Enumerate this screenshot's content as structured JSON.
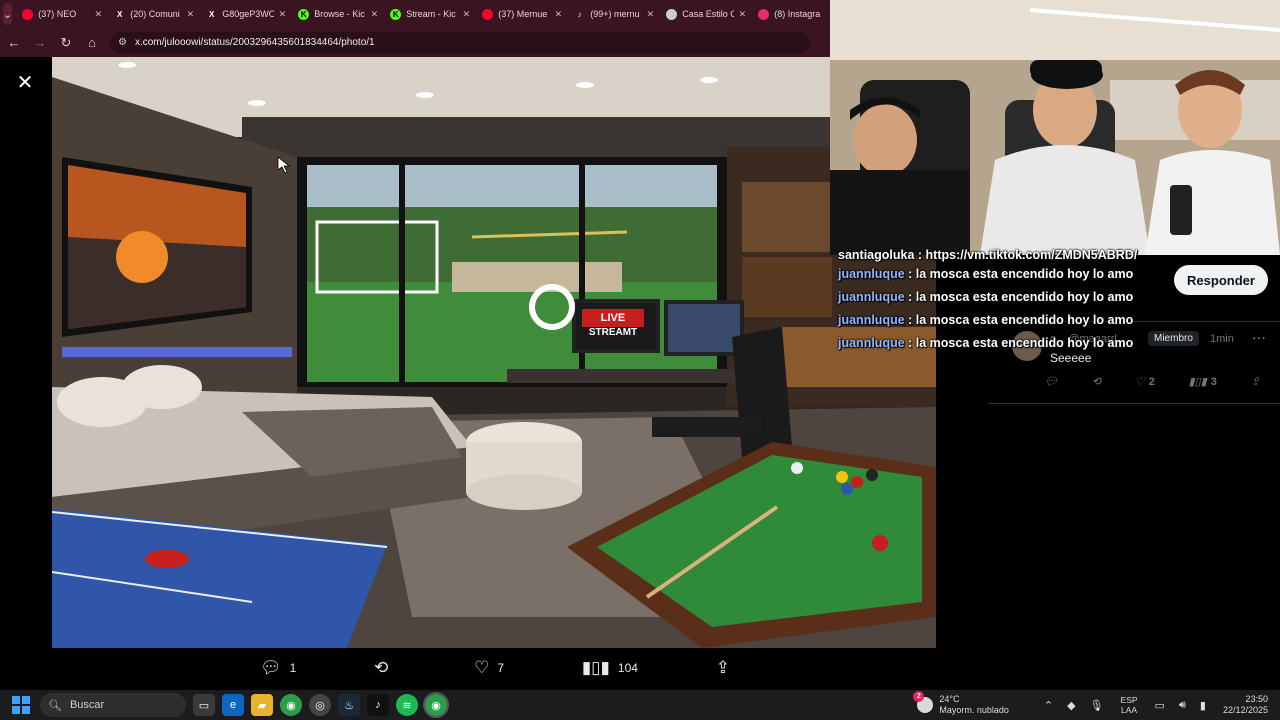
{
  "browser": {
    "tabs": [
      {
        "label": "(37) NEO",
        "icon": "youtube-icon",
        "color": "#ff0033",
        "muted": true
      },
      {
        "label": "(20) Comuni",
        "icon": "x-icon",
        "color": "#ffffff"
      },
      {
        "label": "G80geP3WO",
        "icon": "x-icon",
        "color": "#ffffff"
      },
      {
        "label": "Browse - Kic",
        "icon": "kick-icon",
        "color": "#53fc18"
      },
      {
        "label": "Stream - Kic",
        "icon": "kick-icon",
        "color": "#53fc18"
      },
      {
        "label": "(37) Mernue",
        "icon": "youtube-icon",
        "color": "#ff0033"
      },
      {
        "label": "(99+) mernu",
        "icon": "tiktok-icon",
        "color": "#ffffff"
      },
      {
        "label": "Casa Estilo G",
        "icon": "globe-icon",
        "color": "#cccccc"
      },
      {
        "label": "(8) Instagra",
        "icon": "instagram-icon",
        "color": "#e1306c"
      }
    ],
    "url": "x.com/julooowi/status/2003296435601834464/photo/1"
  },
  "photo": {
    "banner_line1": "LIVE",
    "banner_line2": "STREAMT"
  },
  "post_actions": {
    "replies": "1",
    "reposts": "",
    "likes": "7",
    "views": "104"
  },
  "sidebar": {
    "reply_button": "Responder",
    "member": {
      "handle": "o... @maaarrl...",
      "badge": "Miembro",
      "time": "1min",
      "message": "Seeeee"
    },
    "reply_actions": {
      "likes": "2",
      "views": "3"
    }
  },
  "chat": {
    "top_line": "santiagoluka : https://vm.tiktok.com/ZMDN5ABRD/",
    "messages": [
      {
        "user": "juannluque",
        "text": " : la mosca esta encendido hoy lo amo"
      },
      {
        "user": "juannluque",
        "text": " : la mosca esta encendido hoy lo amo"
      },
      {
        "user": "juannluque",
        "text": " : la mosca esta encendido hoy lo amo"
      },
      {
        "user": "juannluque",
        "text": " : la mosca esta encendido hoy lo amo"
      }
    ]
  },
  "taskbar": {
    "search_placeholder": "Buscar",
    "weather_temp": "24°C",
    "weather_desc": "Mayorm. nublado",
    "weather_badge": "2",
    "lang_line1": "ESP",
    "lang_line2": "LAA",
    "time": "23:50",
    "date": "22/12/2025"
  }
}
